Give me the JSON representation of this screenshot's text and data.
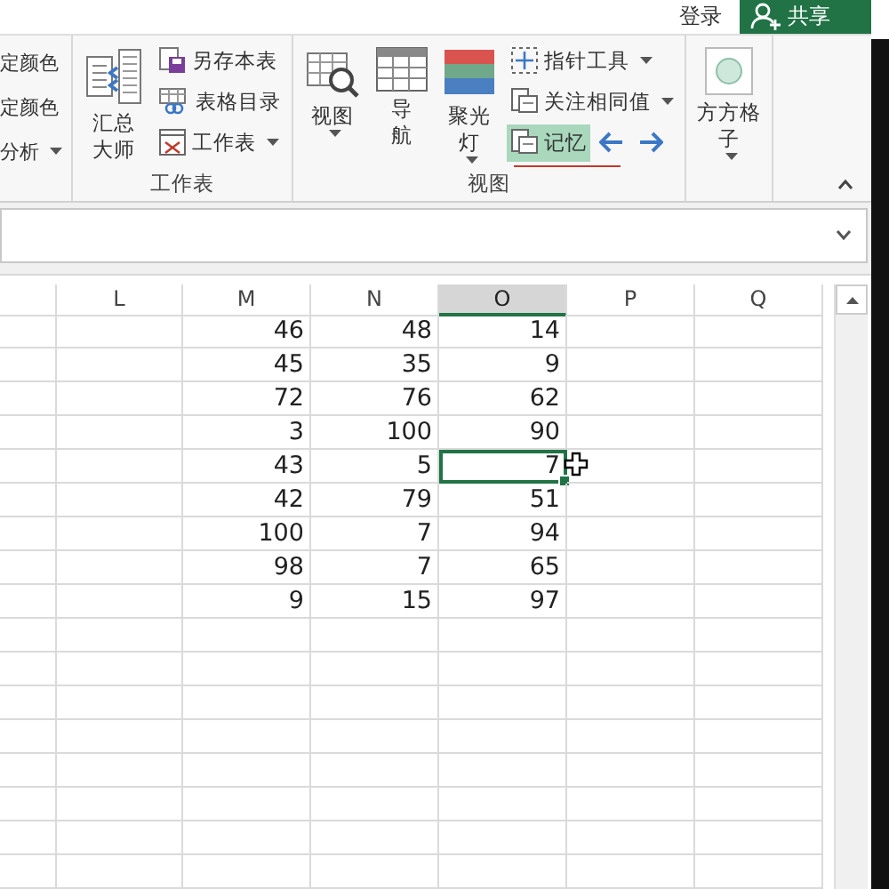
{
  "top_bar": {
    "sign_in": "登录",
    "share": "共享"
  },
  "ribbon": {
    "partial_group": {
      "items": [
        {
          "label": "定颜色"
        },
        {
          "label": "定颜色"
        },
        {
          "label": "分析",
          "dropdown": true
        }
      ]
    },
    "groups": [
      {
        "label": "工作表",
        "buttons": [
          {
            "kind": "large",
            "lines": [
              "汇总",
              "大师"
            ],
            "dropdown": false
          },
          {
            "kind": "column",
            "items": [
              {
                "label": "另存本表",
                "dropdown": false,
                "selected": false
              },
              {
                "label": "表格目录",
                "dropdown": false,
                "selected": false
              },
              {
                "label": "工作表",
                "dropdown": true,
                "selected": false
              }
            ]
          }
        ]
      },
      {
        "label": "视图",
        "buttons": [
          {
            "kind": "large",
            "lines": [
              "视图"
            ],
            "dropdown": true
          },
          {
            "kind": "large",
            "lines": [
              "导",
              "航"
            ],
            "dropdown": false
          },
          {
            "kind": "large",
            "lines": [
              "聚光",
              "灯"
            ],
            "dropdown": true
          },
          {
            "kind": "column",
            "items": [
              {
                "label": "指针工具",
                "dropdown": true,
                "selected": false
              },
              {
                "label": "关注相同值",
                "dropdown": true,
                "selected": false
              },
              {
                "label": "记忆",
                "dropdown": false,
                "selected": true,
                "arrows": true
              }
            ]
          }
        ]
      },
      {
        "buttons": [
          {
            "kind": "large",
            "lines": [
              "方方格",
              "子"
            ],
            "dropdown": true
          }
        ]
      }
    ]
  },
  "sheet": {
    "columns": [
      {
        "label": "L",
        "selected": false
      },
      {
        "label": "M",
        "selected": false
      },
      {
        "label": "N",
        "selected": false
      },
      {
        "label": "O",
        "selected": true
      },
      {
        "label": "P",
        "selected": false
      },
      {
        "label": "Q",
        "selected": false
      }
    ],
    "rows": [
      {
        "cells": [
          {
            "value": "46",
            "selected": false
          },
          {
            "value": "48",
            "selected": false
          },
          {
            "value": "14",
            "selected": false
          }
        ]
      },
      {
        "cells": [
          {
            "value": "45",
            "selected": false
          },
          {
            "value": "35",
            "selected": false
          },
          {
            "value": "9",
            "selected": false
          }
        ]
      },
      {
        "cells": [
          {
            "value": "72",
            "selected": false
          },
          {
            "value": "76",
            "selected": false
          },
          {
            "value": "62",
            "selected": false
          }
        ]
      },
      {
        "cells": [
          {
            "value": "3",
            "selected": false
          },
          {
            "value": "100",
            "selected": false
          },
          {
            "value": "90",
            "selected": false
          }
        ]
      },
      {
        "cells": [
          {
            "value": "43",
            "selected": false
          },
          {
            "value": "5",
            "selected": false
          },
          {
            "value": "7",
            "selected": true
          }
        ]
      },
      {
        "cells": [
          {
            "value": "42",
            "selected": false
          },
          {
            "value": "79",
            "selected": false
          },
          {
            "value": "51",
            "selected": false
          }
        ]
      },
      {
        "cells": [
          {
            "value": "100",
            "selected": false
          },
          {
            "value": "7",
            "selected": false
          },
          {
            "value": "94",
            "selected": false
          }
        ]
      },
      {
        "cells": [
          {
            "value": "98",
            "selected": false
          },
          {
            "value": "7",
            "selected": false
          },
          {
            "value": "65",
            "selected": false
          }
        ]
      },
      {
        "cells": [
          {
            "value": "9",
            "selected": false
          },
          {
            "value": "15",
            "selected": false
          },
          {
            "value": "97",
            "selected": false
          }
        ]
      }
    ]
  }
}
